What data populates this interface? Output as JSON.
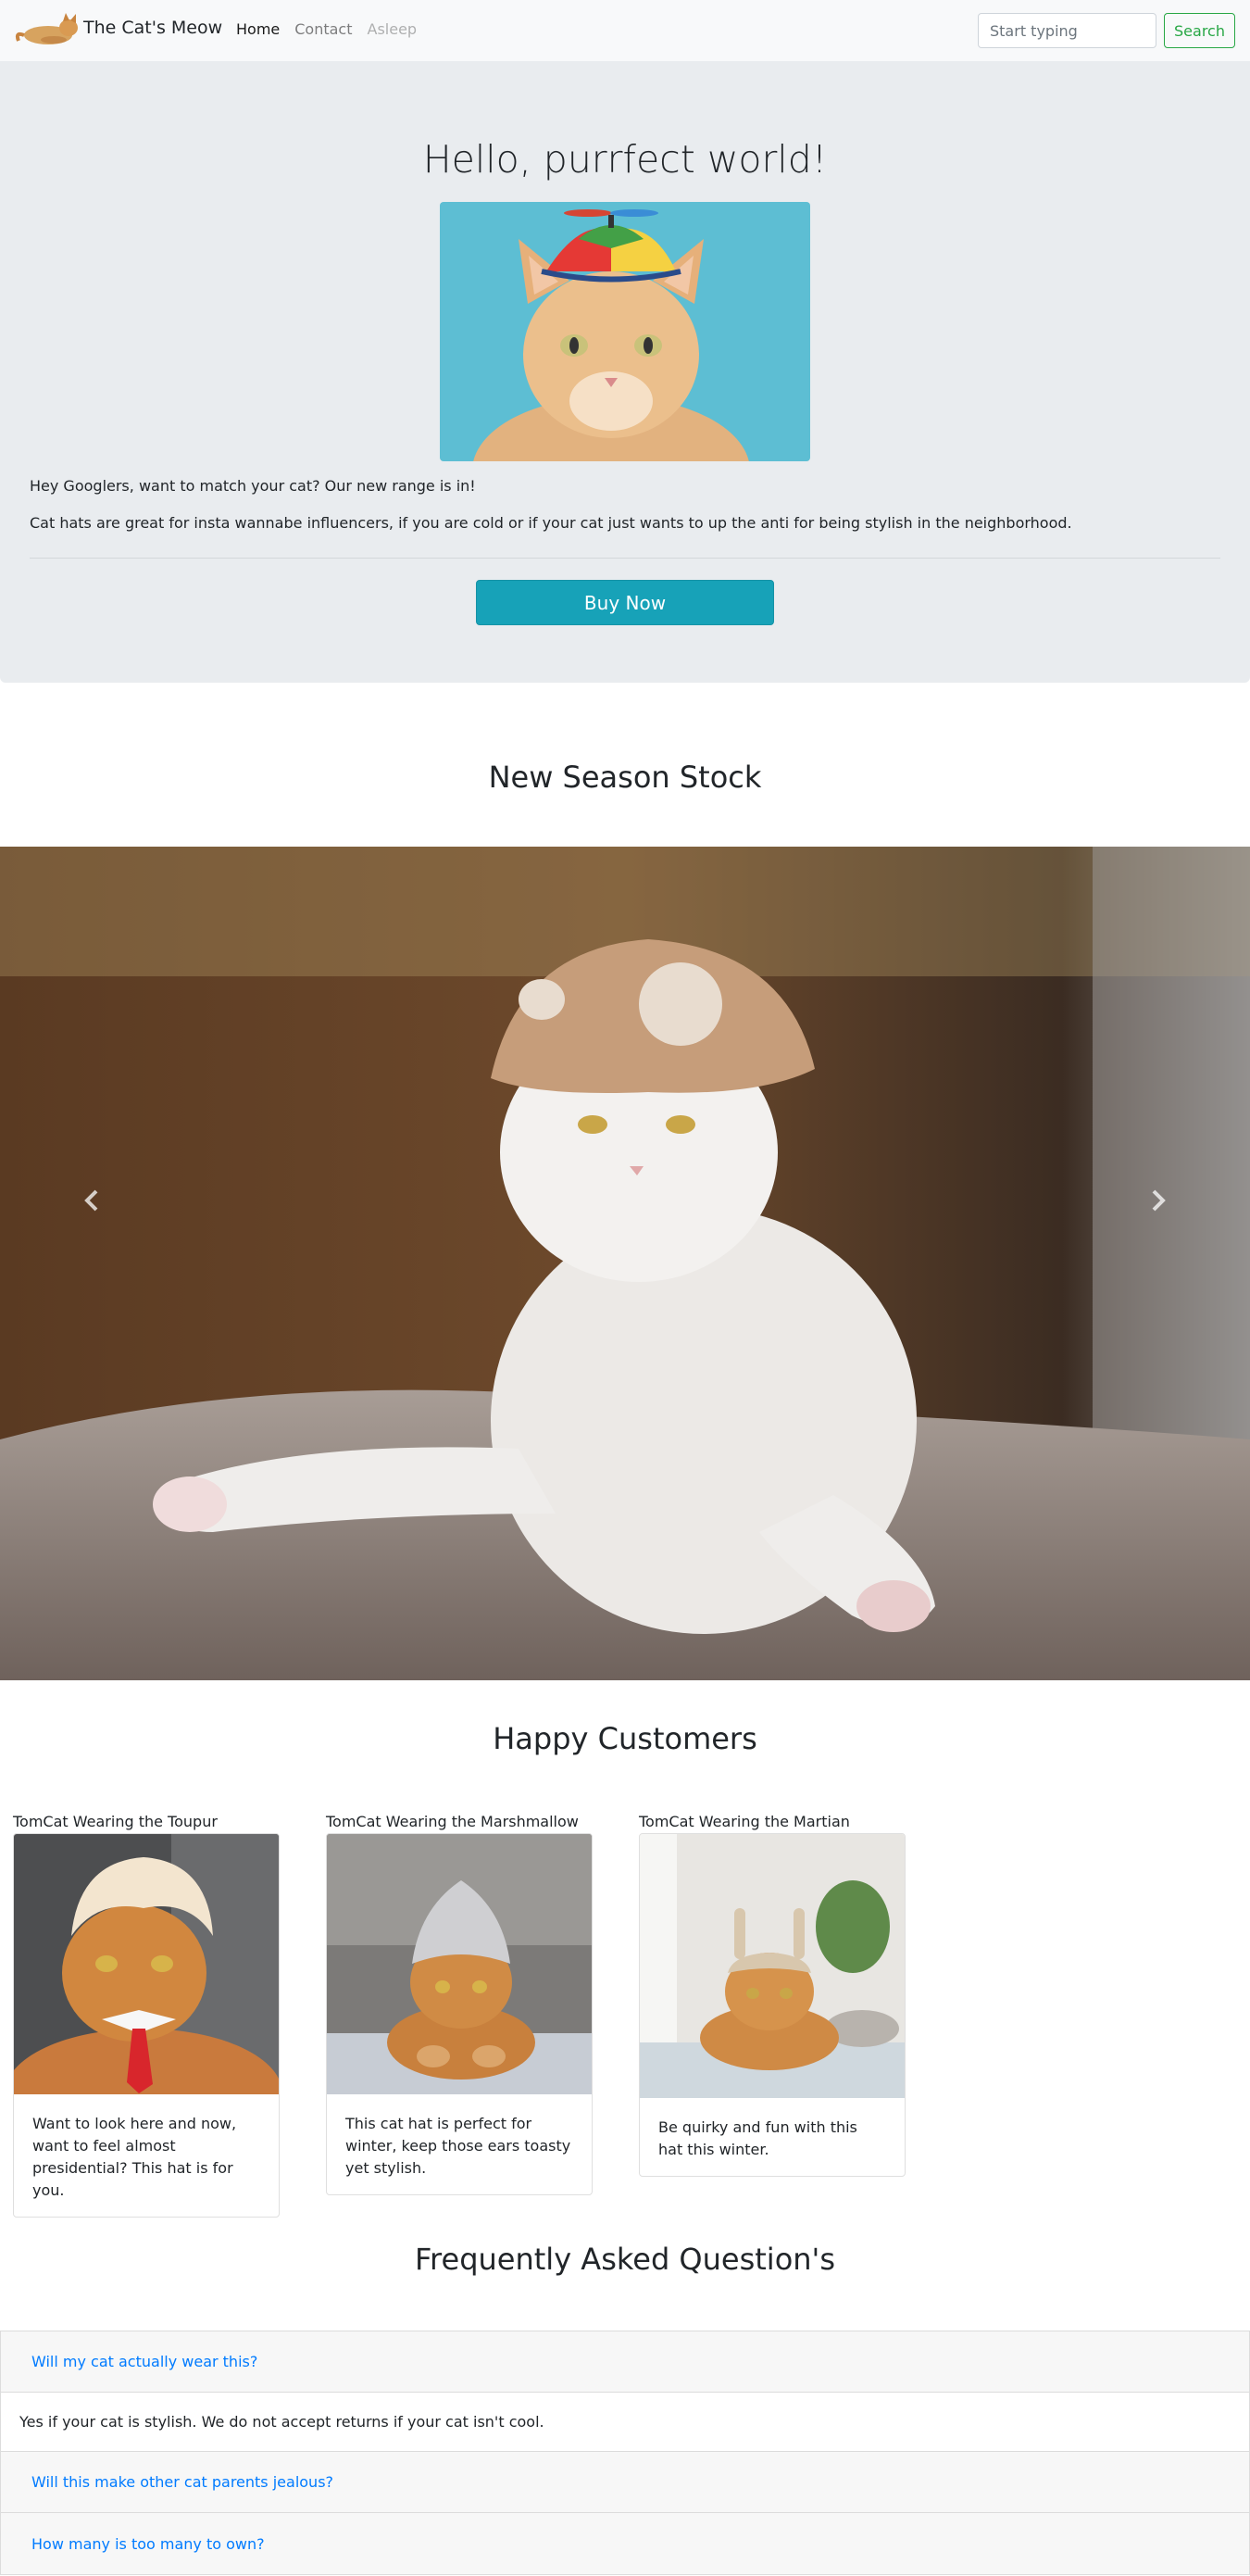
{
  "navbar": {
    "brand": "The Cat's Meow",
    "links": [
      {
        "label": "Home",
        "state": "active"
      },
      {
        "label": "Contact",
        "state": "normal"
      },
      {
        "label": "Asleep",
        "state": "disabled"
      }
    ],
    "search_placeholder": "Start typing",
    "search_button": "Search"
  },
  "hero": {
    "title": "Hello, purrfect world!",
    "text1": "Hey Googlers, want to match your cat? Our new range is in!",
    "text2": "Cat hats are great for insta wannabe influencers, if you are cold or if your cat just wants to up the anti for being stylish in the neighborhood.",
    "button": "Buy Now"
  },
  "new_stock": {
    "title": "New Season Stock",
    "prev_icon": "chevron-left-icon",
    "next_icon": "chevron-right-icon"
  },
  "customers": {
    "title": "Happy Customers",
    "cards": [
      {
        "heading": "TomCat Wearing the Toupur",
        "text": "Want to look here and now, want to feel almost presidential? This hat is for you."
      },
      {
        "heading": "TomCat Wearing the Marshmallow",
        "text": "This cat hat is perfect for winter, keep those ears toasty yet stylish."
      },
      {
        "heading": "TomCat Wearing the Martian",
        "text": "Be quirky and fun with this hat this winter."
      }
    ]
  },
  "faq": {
    "title": "Frequently Asked Question's",
    "items": [
      {
        "question": "Will my cat actually wear this?",
        "answer": "Yes if your cat is stylish. We do not accept returns if your cat isn't cool."
      },
      {
        "question": "Will this make other cat parents jealous?"
      },
      {
        "question": "How many is too many to own?"
      }
    ]
  },
  "colors": {
    "navbar_bg": "#f8f9fa",
    "jumbotron_bg": "#e9ecef",
    "buy_button": "#17a2b8",
    "search_button": "#28a745",
    "link": "#007bff"
  }
}
